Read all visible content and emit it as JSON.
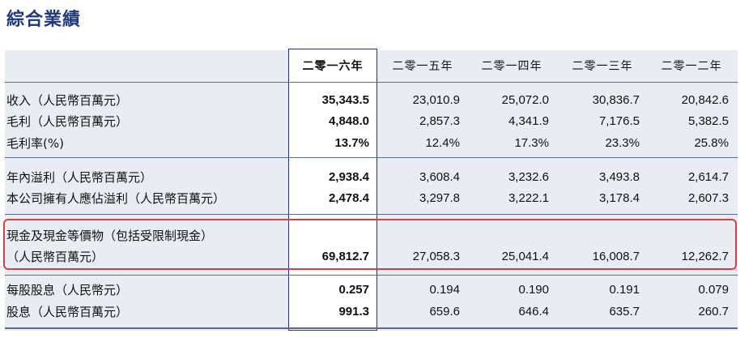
{
  "title": "綜合業績",
  "columns": [
    "二零一六年",
    "二零一五年",
    "二零一四年",
    "二零一三年",
    "二零一二年"
  ],
  "rows": [
    {
      "label": "收入（人民幣百萬元）",
      "values": [
        "35,343.5",
        "23,010.9",
        "25,072.0",
        "30,836.7",
        "20,842.6"
      ]
    },
    {
      "label": "毛利（人民幣百萬元）",
      "values": [
        "4,848.0",
        "2,857.3",
        "4,341.9",
        "7,176.5",
        "5,382.5"
      ]
    },
    {
      "label": "毛利率(%)",
      "values": [
        "13.7%",
        "12.4%",
        "17.3%",
        "23.3%",
        "25.8%"
      ]
    },
    {
      "label": "年內溢利（人民幣百萬元）",
      "values": [
        "2,938.4",
        "3,608.4",
        "3,232.6",
        "3,493.8",
        "2,614.7"
      ]
    },
    {
      "label": "本公司擁有人應佔溢利（人民幣百萬元）",
      "values": [
        "2,478.4",
        "3,297.8",
        "3,222.1",
        "3,178.4",
        "2,607.3"
      ]
    },
    {
      "label": "現金及現金等價物（包括受限制現金）",
      "label2": "（人民幣百萬元）",
      "values": [
        "69,812.7",
        "27,058.3",
        "25,041.4",
        "16,008.7",
        "12,262.7"
      ]
    },
    {
      "label": "每股股息（人民幣元）",
      "values": [
        "0.257",
        "0.194",
        "0.190",
        "0.191",
        "0.079"
      ]
    },
    {
      "label": "股息（人民幣百萬元）",
      "values": [
        "991.3",
        "659.6",
        "646.4",
        "635.7",
        "260.7"
      ]
    }
  ],
  "colors": {
    "title": "#1f3a7a",
    "table_background": "#e8edf4",
    "highlight_border": "#2a2f8a",
    "red_box": "#d94040"
  }
}
